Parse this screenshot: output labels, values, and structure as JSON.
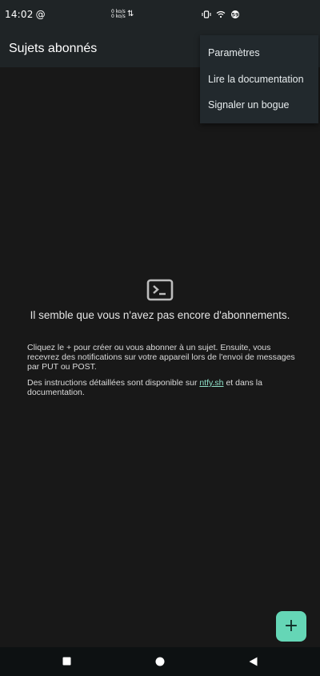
{
  "status_bar": {
    "time": "14:02",
    "at_sign": "@",
    "net_up": "0 ko/s",
    "net_down": "0 ko/s",
    "net_arrows": "⇅",
    "icons": [
      "vibrate-icon",
      "wifi-icon",
      "battery-saver-icon"
    ]
  },
  "app_bar": {
    "title": "Sujets abonnés"
  },
  "menu": {
    "items": [
      {
        "label": "Paramètres"
      },
      {
        "label": "Lire la documentation"
      },
      {
        "label": "Signaler un bogue"
      }
    ]
  },
  "empty_state": {
    "icon": "terminal-icon",
    "heading": "Il semble que vous n'avez pas encore d'abonnements.",
    "paragraph1": "Cliquez le + pour créer ou vous abonner à un sujet. Ensuite, vous recevrez des notifications sur votre appareil lors de l'envoi de messages par PUT ou POST.",
    "paragraph2_before": "Des instructions détaillées sont disponible sur ",
    "paragraph2_link": "ntfy.sh",
    "paragraph2_after": " et dans la documentation."
  },
  "fab": {
    "label": "+",
    "color": "#65d6b6"
  },
  "nav_bar": {
    "buttons": [
      "recents-square-icon",
      "home-circle-icon",
      "back-triangle-icon"
    ]
  },
  "colors": {
    "background": "#181818",
    "app_bar": "#1f2426",
    "menu": "#22292d",
    "accent": "#65d6b6",
    "link": "#8fe0c8"
  }
}
